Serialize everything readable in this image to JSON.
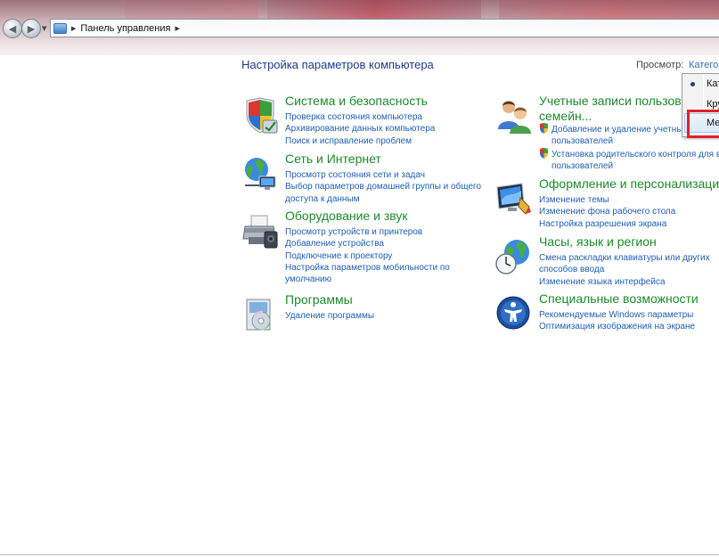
{
  "address": {
    "path": "Панель управления"
  },
  "header": {
    "title": "Настройка параметров компьютера",
    "view_label": "Просмотр:",
    "view_value": "Категор"
  },
  "view_menu": {
    "items": [
      {
        "label": "Кат",
        "selected": true
      },
      {
        "label": "Кру"
      },
      {
        "label": "Ме"
      }
    ]
  },
  "categories": {
    "system": {
      "title": "Система и безопасность",
      "icon": "shield-icon",
      "links": [
        "Проверка состояния компьютера",
        "Архивирование данных компьютера",
        "Поиск и исправление проблем"
      ]
    },
    "network": {
      "title": "Сеть и Интернет",
      "icon": "network-globe-icon",
      "links": [
        "Просмотр состояния сети и задач",
        "Выбор параметров домашней группы и общего",
        "доступа к данным"
      ]
    },
    "hardware": {
      "title": "Оборудование и звук",
      "icon": "printer-icon",
      "links": [
        "Просмотр устройств и принтеров",
        "Добавление устройства",
        "Подключение к проектору",
        "Настройка параметров мобильности по",
        "умолчанию"
      ]
    },
    "programs": {
      "title": "Программы",
      "icon": "programs-icon",
      "links": [
        "Удаление программы"
      ]
    },
    "accounts": {
      "title_line1": "Учетные записи пользовате",
      "title_line2": "семейн...",
      "icon": "users-icon",
      "links": [
        "Добавление и удаление учетных",
        "пользователей",
        "Установка родительского контроля для все",
        "пользователей"
      ]
    },
    "appearance": {
      "title": "Оформление и персонализация",
      "icon": "monitor-icon",
      "links": [
        "Изменение темы",
        "Изменение фона рабочего стола",
        "Настройка разрешения экрана"
      ]
    },
    "clock": {
      "title": "Часы, язык и регион",
      "icon": "clock-globe-icon",
      "links": [
        "Смена раскладки клавиатуры или других",
        "способов ввода",
        "Изменение языка интерфейса"
      ]
    },
    "access": {
      "title": "Специальные возможности",
      "icon": "accessibility-icon",
      "links": [
        "Рекомендуемые Windows параметры",
        "Оптимизация изображения на экране"
      ]
    }
  }
}
